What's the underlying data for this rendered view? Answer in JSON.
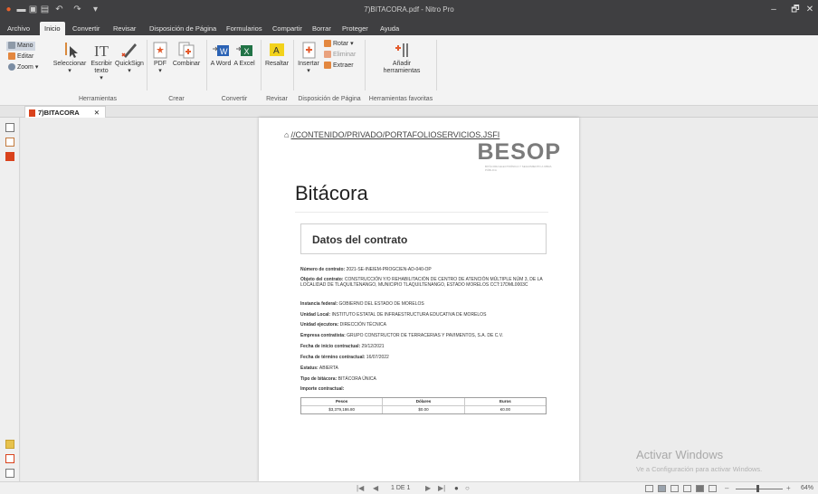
{
  "titlebar": {
    "title": "7)BITACORA.pdf - Nitro Pro",
    "quick_access_icons": [
      "nitro-logo-icon",
      "open-folder-icon",
      "save-icon",
      "print-icon",
      "undo-icon",
      "redo-icon",
      "customize-icon"
    ],
    "minimize": "–",
    "restore": "🗗",
    "close": "✕"
  },
  "menu": {
    "tabs": [
      "Archivo",
      "Inicio",
      "Convertir",
      "Revisar",
      "Disposición de Página",
      "Formularios",
      "Compartir",
      "Borrar",
      "Proteger",
      "Ayuda"
    ],
    "active": "Inicio"
  },
  "ribbon": {
    "view_tools": {
      "mano": "Mano",
      "editar": "Editar",
      "zoom": "Zoom"
    },
    "herramientas": {
      "label": "Herramientas",
      "seleccionar": "Seleccionar",
      "escribir": "Escribir texto",
      "quicksign": "QuickSign"
    },
    "crear": {
      "label": "Crear",
      "pdf": "PDF",
      "combinar": "Combinar"
    },
    "convertir": {
      "label": "Convertir",
      "a_word": "A Word",
      "a_excel": "A Excel"
    },
    "revisar": {
      "label": "Revisar",
      "resaltar": "Resaltar"
    },
    "disposicion": {
      "label": "Disposición de Página",
      "insertar": "Insertar",
      "rotar": "Rotar",
      "eliminar": "Eliminar",
      "extraer": "Extraer"
    },
    "favoritas": {
      "label": "Herramientas favoritas",
      "anadir": "Añadir herramientas"
    }
  },
  "doc_tab": {
    "label": "7)BITACORA",
    "close": "✕"
  },
  "document": {
    "link": "//CONTENIDO/PRIVADO/PORTAFOLIOSERVICIOS.JSFI",
    "brand": "BESOP",
    "brand_sub": "BITÁCORA ELECTRÓNICA Y SEGUIMIENTO A OBRA PÚBLICA",
    "title": "Bitácora",
    "section_title": "Datos del contrato",
    "fields": [
      {
        "label": "Número de contrato:",
        "value": "2021-SE-INEIEM-PROGCIEN-AD-040-OP"
      },
      {
        "label": "Objeto del contrato:",
        "value": "CONSTRUCCIÓN Y/O REHABILITACIÓN DE CENTRO DE ATENCIÓN MÚLTIPLE NÚM 3, DE LA LOCALIDAD DE TLAQUILTENANGO, MUNICIPIO TLAQUILTENANGO, ESTADO MORELOS CCT:17DML0003C"
      },
      {
        "label": "Instancia federal:",
        "value": "GOBIERNO DEL ESTADO DE MORELOS"
      },
      {
        "label": "Unidad Local:",
        "value": "INSTITUTO ESTATAL DE INFRAESTRUCTURA EDUCATIVA DE MORELOS"
      },
      {
        "label": "Unidad ejecutora:",
        "value": "DIRECCIÓN TÉCNICA"
      },
      {
        "label": "Empresa contratista:",
        "value": "GRUPO CONSTRUCTOR DE TERRACERIAS Y PAVIMENTOS, S.A. DE C.V."
      },
      {
        "label": "Fecha de inicio contractual:",
        "value": "29/12/2021"
      },
      {
        "label": "Fecha de término contractual:",
        "value": "16/07/2022"
      },
      {
        "label": "Estatus:",
        "value": "ABIERTA"
      },
      {
        "label": "Tipo de bitácora:",
        "value": "BITÁCORA ÚNICA"
      },
      {
        "label": "Importe contractual:",
        "value": ""
      }
    ],
    "table": {
      "headers": [
        "Pesos",
        "Dólares",
        "Euros"
      ],
      "values": [
        "$3,379,186.80",
        "$0.00",
        "€0.00"
      ]
    }
  },
  "watermark": {
    "title": "Activar Windows",
    "sub": "Ve a Configuración para activar Windows."
  },
  "status": {
    "page_indicator": "1 DE 1",
    "zoom": "64%"
  }
}
